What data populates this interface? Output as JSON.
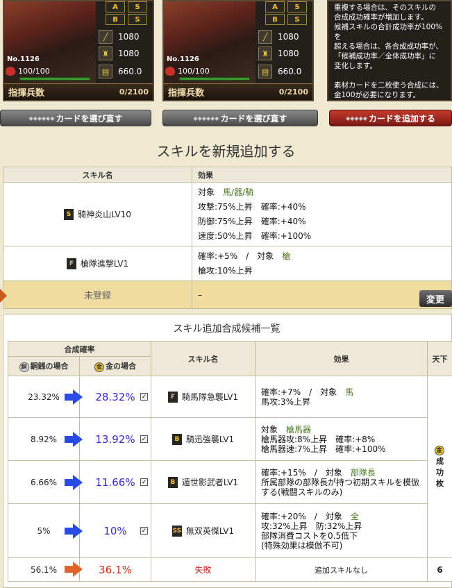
{
  "cards": [
    {
      "number": "No.1126",
      "hp": "100/100",
      "atk": "1080",
      "def": "1080",
      "spd": "660.0",
      "command_label": "指揮兵数",
      "command_value": "0/2100",
      "reselect_label": "カードを選び直す"
    },
    {
      "number": "No.1126",
      "hp": "100/100",
      "atk": "1080",
      "def": "1080",
      "spd": "660.0",
      "command_label": "指揮兵数",
      "command_value": "0/2100",
      "reselect_label": "カードを選び直す"
    }
  ],
  "info_text": [
    "重複する場合は、そのスキルの",
    "合成成功確率が増加します。",
    "候補スキルの合計成功率が100%を",
    "超える場合は、各合成成功率が、",
    "「候補成功率／全体成功率」に",
    "変化します。",
    "",
    "素材カードを二枚使う合成には、",
    "金100が必要になります。"
  ],
  "add_card_label": "カードを追加する",
  "heading": "スキルを新規追加する",
  "skill_table": {
    "headers": [
      "スキル名",
      "効果"
    ],
    "rows": [
      {
        "rank": "S",
        "name": "騎神炎山LV10",
        "effects": [
          "対象",
          "馬/器/騎",
          "攻撃:75%上昇　確率:+40%",
          "防御:75%上昇　確率:+40%",
          "速度:50%上昇　確率:+100%"
        ]
      },
      {
        "rank": "F",
        "name": "槍隊進撃LV1",
        "effects": [
          "確率:+5%　/　対象",
          "槍",
          "槍攻:10%上昇"
        ]
      },
      {
        "name": "未登録",
        "effect": "–",
        "change_label": "変更"
      }
    ]
  },
  "candidates": {
    "title": "スキル追加合成候補一覧",
    "headers": {
      "rate": "合成確率",
      "copper": "銅銭の場合",
      "gold": "金の場合",
      "name": "スキル名",
      "effect": "効果",
      "side": "天下"
    },
    "rows": [
      {
        "copper": "23.32%",
        "gold": "28.32%",
        "rank": "F",
        "name": "騎馬隊急襲LV1",
        "effect": [
          "確率:+7%　/　対象",
          "馬",
          "馬攻:3%上昇"
        ]
      },
      {
        "copper": "8.92%",
        "gold": "13.92%",
        "rank": "B",
        "name": "騎迅強襲LV1",
        "effect": [
          "対象",
          "槍馬器",
          "槍馬器攻:8%上昇　確率:+8%",
          "槍馬器速:7%上昇　確率:+100%"
        ]
      },
      {
        "copper": "6.66%",
        "gold": "11.66%",
        "rank": "B",
        "name": "遁世影武者LV1",
        "effect": [
          "確率:+15%　/　対象",
          "部隊長",
          "所属部隊の部隊長が持つ初期スキルを模倣",
          "する(戦闘スキルのみ)"
        ]
      },
      {
        "copper": "5%",
        "gold": "10%",
        "rank": "SS",
        "name": "無双英傑LV1",
        "effect": [
          "確率:+20%　/　対象",
          "全",
          "攻:32%上昇　防:32%上昇",
          "部隊消費コストを0.5低下",
          "(特殊効果は模倣不可)"
        ]
      },
      {
        "copper": "56.1%",
        "gold": "36.1%",
        "fail": "失敗",
        "effect": "追加スキルなし"
      }
    ],
    "side_text": [
      "成",
      "功",
      "枚"
    ],
    "side_bottom": "6"
  }
}
